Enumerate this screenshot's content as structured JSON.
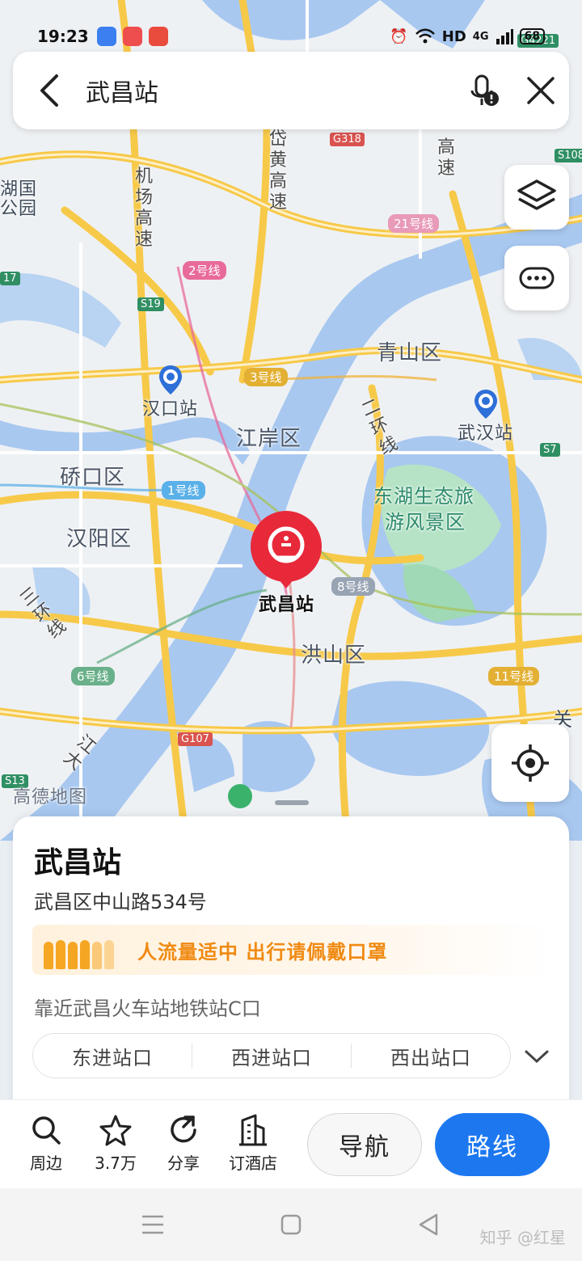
{
  "status_bar": {
    "time": "19:23",
    "network": "HD",
    "signal": "4G",
    "battery": "68"
  },
  "search": {
    "query": "武昌站"
  },
  "map": {
    "district_labels": [
      "青山区",
      "江岸区",
      "硚口区",
      "汉阳区",
      "洪山区",
      "东湖生态旅",
      "游风景区",
      "湖国",
      "公园"
    ],
    "station_labels": [
      "汉口站",
      "武汉站",
      "武昌站"
    ],
    "road_labels_vertical": [
      "岱黄高速",
      "机场高速",
      "高速",
      "二环线",
      "三环线",
      "江大"
    ],
    "metro_lines": [
      "2号线",
      "3号线",
      "1号线",
      "21号线",
      "8号线",
      "6号线",
      "11号线"
    ],
    "highway_badges": [
      "G318",
      "S19",
      "S7",
      "G107",
      "S13",
      "S108",
      "17",
      "G4221"
    ],
    "edge_text": "关",
    "logo_text": "高德地图",
    "selected_marker": "武昌站"
  },
  "place": {
    "name": "武昌站",
    "address": "武昌区中山路534号",
    "crowd_notice": "人流量适中 出行请佩戴口罩",
    "nearby": "靠近武昌火车站地铁站C口",
    "entrances": [
      "东进站口",
      "西进站口",
      "西出站口"
    ]
  },
  "actions": {
    "nearby_label": "周边",
    "favorite_count": "3.7万",
    "share_label": "分享",
    "hotel_label": "订酒店",
    "navigate_label": "导航",
    "route_label": "路线"
  },
  "watermark": "知乎 @红星",
  "colors": {
    "accent": "#1d78f0",
    "marker": "#e8293a",
    "crowd": "#f08a12",
    "water": "#a8c8f0",
    "park": "#9fd9b5",
    "road": "#f7c948"
  }
}
